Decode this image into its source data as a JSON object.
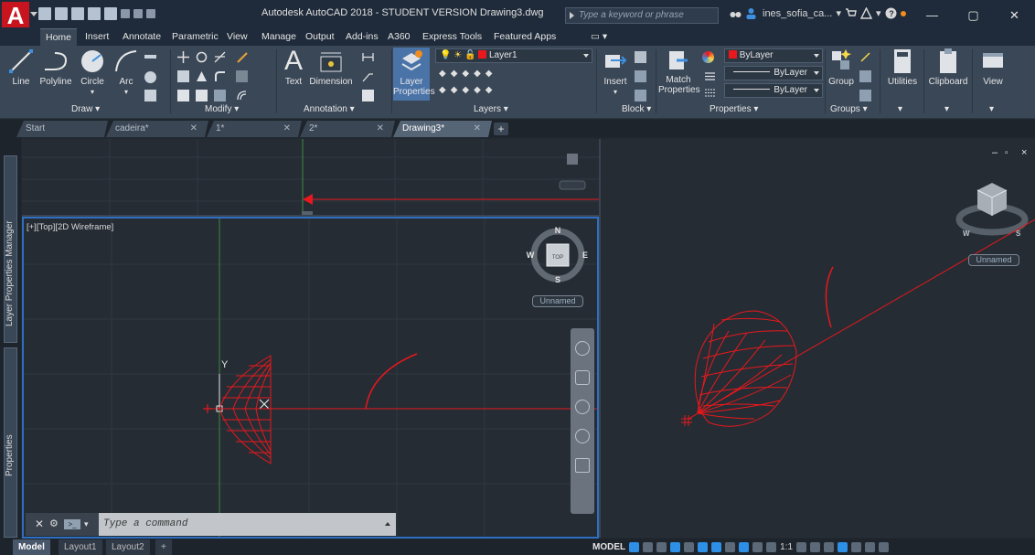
{
  "window": {
    "title": "Autodesk AutoCAD 2018 - STUDENT VERSION    Drawing3.dwg",
    "app_logo": "A",
    "search_placeholder": "Type a keyword or phrase",
    "user_name": "ines_sofia_ca...",
    "controls": {
      "minimize": "—",
      "maximize": "▢",
      "close": "✕"
    }
  },
  "ribbon_tabs": [
    "Home",
    "Insert",
    "Annotate",
    "Parametric",
    "View",
    "Manage",
    "Output",
    "Add-ins",
    "A360",
    "Express Tools",
    "Featured Apps"
  ],
  "ribbon": {
    "draw": {
      "line": "Line",
      "polyline": "Polyline",
      "circle": "Circle",
      "arc": "Arc",
      "panel": "Draw ▾"
    },
    "modify": {
      "panel": "Modify ▾"
    },
    "annotation": {
      "text": "Text",
      "dimension": "Dimension",
      "panel": "Annotation ▾"
    },
    "layers": {
      "layer_properties_1": "Layer",
      "layer_properties_2": "Properties",
      "current_layer": "Layer1",
      "panel": "Layers ▾"
    },
    "block": {
      "insert": "Insert",
      "panel": "Block ▾"
    },
    "properties": {
      "match_1": "Match",
      "match_2": "Properties",
      "color": "ByLayer",
      "linetype": "ByLayer",
      "lineweight": "ByLayer",
      "panel": "Properties ▾"
    },
    "groups": {
      "group": "Group",
      "panel": "Groups ▾"
    },
    "utilities": "Utilities",
    "clipboard": "Clipboard",
    "view": "View"
  },
  "file_tabs": [
    {
      "label": "Start",
      "active": false
    },
    {
      "label": "cadeira*",
      "active": false
    },
    {
      "label": "1*",
      "active": false
    },
    {
      "label": "2*",
      "active": false
    },
    {
      "label": "Drawing3*",
      "active": true
    }
  ],
  "palettes": {
    "layer_manager": "Layer Properties Manager",
    "properties": "Properties"
  },
  "viewport": {
    "label": "[+][Top][2D Wireframe]",
    "compass": {
      "n": "N",
      "s": "S",
      "e": "E",
      "w": "W",
      "top": "TOP"
    },
    "ucs_name": "Unnamed",
    "axis_y": "Y",
    "axis_x": "X",
    "right_ucs_name": "Unnamed"
  },
  "command_line": {
    "placeholder": "Type a command"
  },
  "layout_tabs": [
    "Model",
    "Layout1",
    "Layout2",
    "+"
  ],
  "status": {
    "model": "MODEL",
    "scale": "1:1"
  },
  "colors": {
    "geometry": "#e8181c",
    "accent": "#2e6fc2"
  }
}
